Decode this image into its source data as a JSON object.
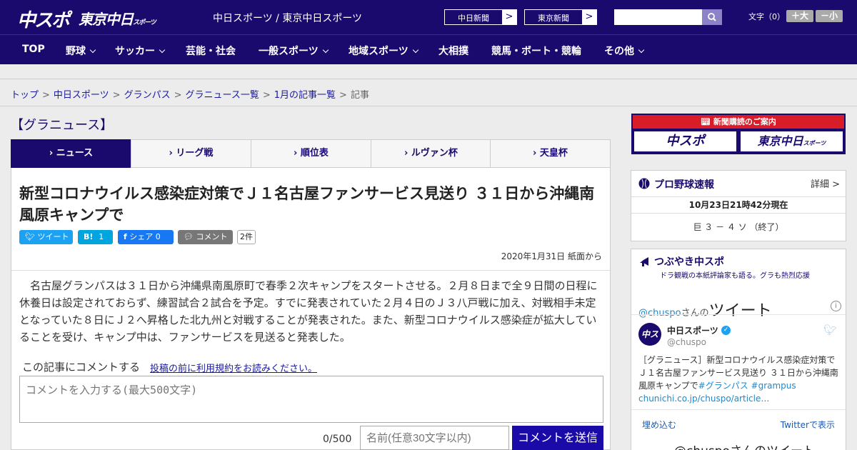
{
  "header": {
    "logo_chuspo": "中スポ",
    "logo_tokyo": "東京中日",
    "logo_tokyo_small": "スポーツ",
    "site_names": "中日スポーツ / 東京中日スポーツ",
    "btn_chunichi": "中日新聞",
    "btn_tokyo": "東京新聞",
    "arrow": ">",
    "search_placeholder": "",
    "font_size_label": "文字（0）",
    "font_larger": "＋大",
    "font_smaller": "－小"
  },
  "nav": {
    "items": [
      "TOP",
      "野球",
      "サッカー",
      "芸能・社会",
      "一般スポーツ",
      "地域スポーツ",
      "大相撲",
      "競馬・ボート・競輪",
      "その他"
    ]
  },
  "breadcrumb": {
    "items": [
      "トップ",
      "中日スポーツ",
      "グランパス",
      "グラニュース一覧",
      "1月の記事一覧",
      "記事"
    ],
    "sep": ">"
  },
  "main": {
    "section_title": "【グラニュース】",
    "tabs": [
      "› ニュース",
      "› リーグ戦",
      "› 順位表",
      "› ルヴァン杯",
      "› 天皇杯"
    ],
    "headline": "新型コロナウイルス感染症対策でＪ１名古屋ファンサービス見送り ３１日から沖縄南風原キャンプで",
    "share": {
      "tweet": "ツイート",
      "hatena_icon": "B!",
      "hatena_count": "1",
      "facebook": "シェア 0",
      "comment": "コメント",
      "count": "2件"
    },
    "pubdate": "2020年1月31日 紙面から",
    "body": "名古屋グランパスは３１日から沖縄県南風原町で春季２次キャンプをスタートさせる。２月８日まで全９日間の日程に休養日は設定されておらず、練習試合２試合を予定。すでに発表されていた２月４日のＪ３八戸戦に加え、対戦相手未定となっていた８日にＪ２へ昇格した北九州と対戦することが発表された。また、新型コロナウイルス感染症が拡大していることを受け、キャンプ中は、ファンサービスを見送ると発表した。",
    "comment": {
      "label": "この記事にコメントする",
      "terms": "投稿の前に利用規約をお読みください。",
      "placeholder": "コメントを入力する(最大500文字)",
      "count": "0/500",
      "name_placeholder": "名前(任意30文字以内)",
      "submit": "コメントを送信"
    }
  },
  "sidebar": {
    "subscription_header": "新聞購読のご案内",
    "sub_logo_1": "中スポ",
    "sub_logo_2": "東京中日",
    "sub_logo_2_small": "スポーツ",
    "baseball": {
      "title": "プロ野球速報",
      "more": "詳細 >",
      "timestamp": "10月23日21時42分現在",
      "score": "巨 ３ － ４ ソ （終了）"
    },
    "twitter": {
      "title": "つぶやき中スポ",
      "subtitle": "ドラ観戦の本紙評論家も語る。グラも熱烈応援",
      "handle": "@chuspo",
      "handle_suffix": "さんの",
      "tweets_label": "ツイート",
      "info": "i",
      "name": "中日スポーツ",
      "verified": "✓",
      "user": "@chuspo",
      "tweet_text": "［グラニュース］新型コロナウイルス感染症対策でＪ１名古屋ファンサービス見送り ３１日から沖縄南風原キャンプで",
      "tweet_tags": "#グランパス #grampus",
      "tweet_link": "chunichi.co.jp/chuspo/article…",
      "embed": "埋め込む",
      "view_on": "Twitterで表示",
      "bottom": "@chuspoさんのツイート"
    }
  },
  "colors": {
    "brand_navy": "#1a0a6e",
    "accent_red": "#d81c28",
    "twitter_blue": "#1da1f2",
    "hatena_blue": "#00a4de",
    "facebook_blue": "#1877f2",
    "comment_gray": "#777777"
  }
}
